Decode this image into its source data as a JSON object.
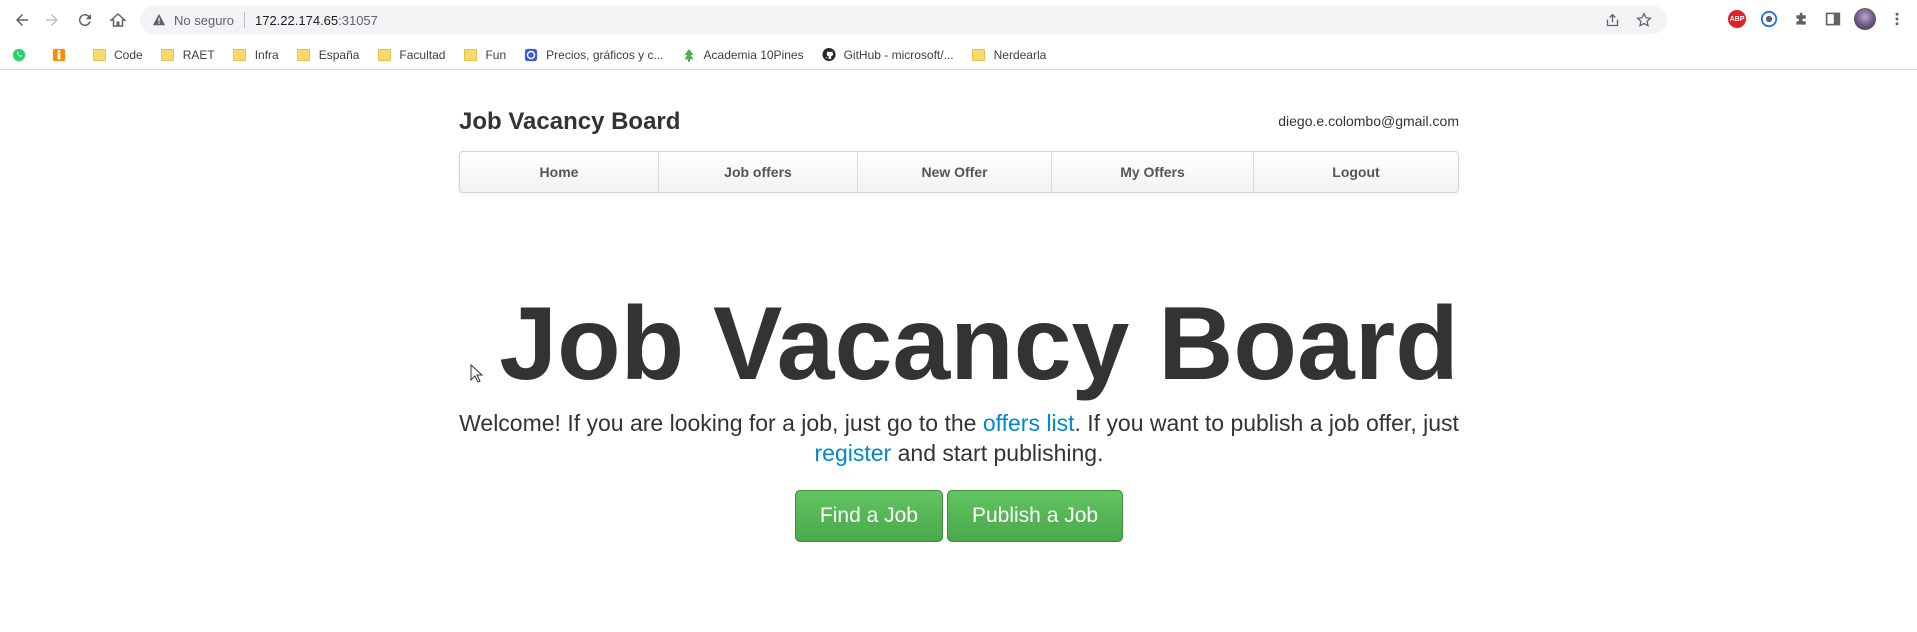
{
  "browser": {
    "security_label": "No seguro",
    "url_host": "172.22.174.65",
    "url_port": ":31057",
    "bookmarks": [
      {
        "label": "",
        "icon": "whatsapp-icon"
      },
      {
        "label": "",
        "icon": "extension-i-icon"
      },
      {
        "label": "Code",
        "icon": "folder-icon"
      },
      {
        "label": "RAET",
        "icon": "folder-icon"
      },
      {
        "label": "Infra",
        "icon": "folder-icon"
      },
      {
        "label": "España",
        "icon": "folder-icon"
      },
      {
        "label": "Facultad",
        "icon": "folder-icon"
      },
      {
        "label": "Fun",
        "icon": "folder-icon"
      },
      {
        "label": "Precios, gráficos y c...",
        "icon": "coingecko-icon"
      },
      {
        "label": "Academia 10Pines",
        "icon": "pine-icon"
      },
      {
        "label": "GitHub - microsoft/...",
        "icon": "github-icon"
      },
      {
        "label": "Nerdearla",
        "icon": "folder-icon"
      }
    ],
    "extensions": {
      "abp_label": "ABP"
    }
  },
  "header": {
    "brand": "Job Vacancy Board",
    "user_email": "diego.e.colombo@gmail.com"
  },
  "navbar": {
    "items": [
      "Home",
      "Job offers",
      "New Offer",
      "My Offers",
      "Logout"
    ]
  },
  "hero": {
    "title": "Job Vacancy Board",
    "text_part1": "Welcome! If you are looking for a job, just go to the ",
    "offers_link": "offers list",
    "text_part2": ". If you want to publish a job offer, just ",
    "register_link": "register",
    "text_part3": " and start publishing.",
    "find_button": "Find a Job",
    "publish_button": "Publish a Job"
  },
  "colors": {
    "link": "#0088cc",
    "button_green": "#5bb75b"
  }
}
